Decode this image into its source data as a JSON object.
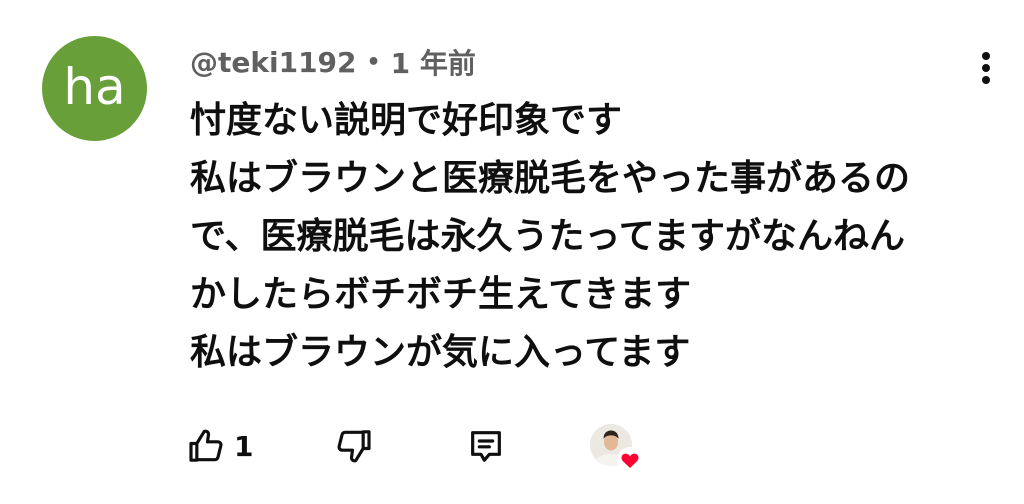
{
  "comment": {
    "avatar_initials": "ha",
    "avatar_color": "#689f38",
    "author": "@teki1192",
    "separator": "•",
    "timestamp": "1 年前",
    "lines": [
      "忖度ない説明で好印象です",
      "私はブラウンと医療脱毛をやった事があるの",
      "で、医療脱毛は永久うたってますがなんねん",
      "かしたらボチボチ生えてきます",
      "私はブラウンが気に入ってます"
    ]
  },
  "actions": {
    "like_count": "1",
    "like_icon": "thumbs-up-icon",
    "dislike_icon": "thumbs-down-icon",
    "reply_icon": "comment-icon",
    "creator_heart_icon": "heart-icon",
    "heart_color": "#ff0033"
  },
  "menu": {
    "icon": "more-vertical-icon"
  }
}
